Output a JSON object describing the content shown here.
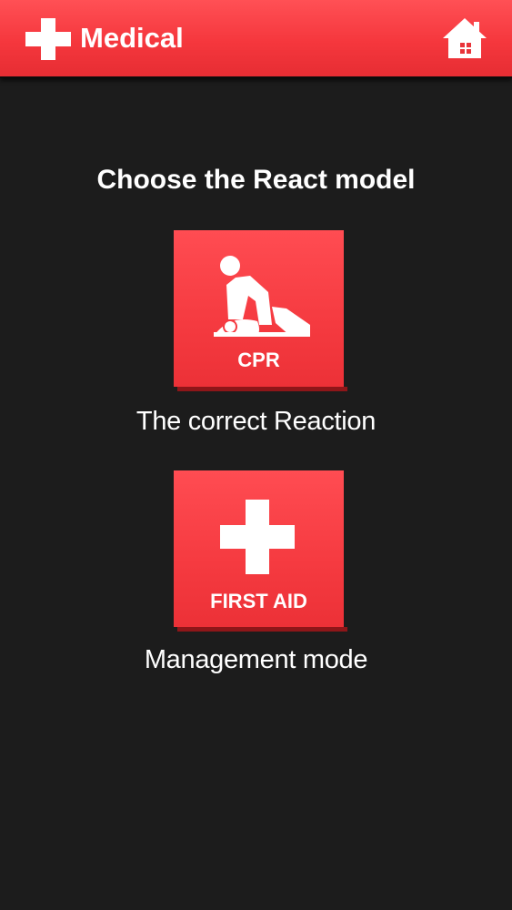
{
  "header": {
    "title": "Medical",
    "logo_icon": "red-cross-icon",
    "home_icon": "home-icon"
  },
  "main": {
    "title": "Choose the React model",
    "options": [
      {
        "label": "CPR",
        "caption": "The correct Reaction",
        "icon": "cpr-icon"
      },
      {
        "label": "FIRST AID",
        "caption": "Management mode",
        "icon": "first-aid-cross-icon"
      }
    ]
  },
  "colors": {
    "accent_red": "#f53a40",
    "background": "#1c1c1c",
    "text": "#ffffff"
  }
}
